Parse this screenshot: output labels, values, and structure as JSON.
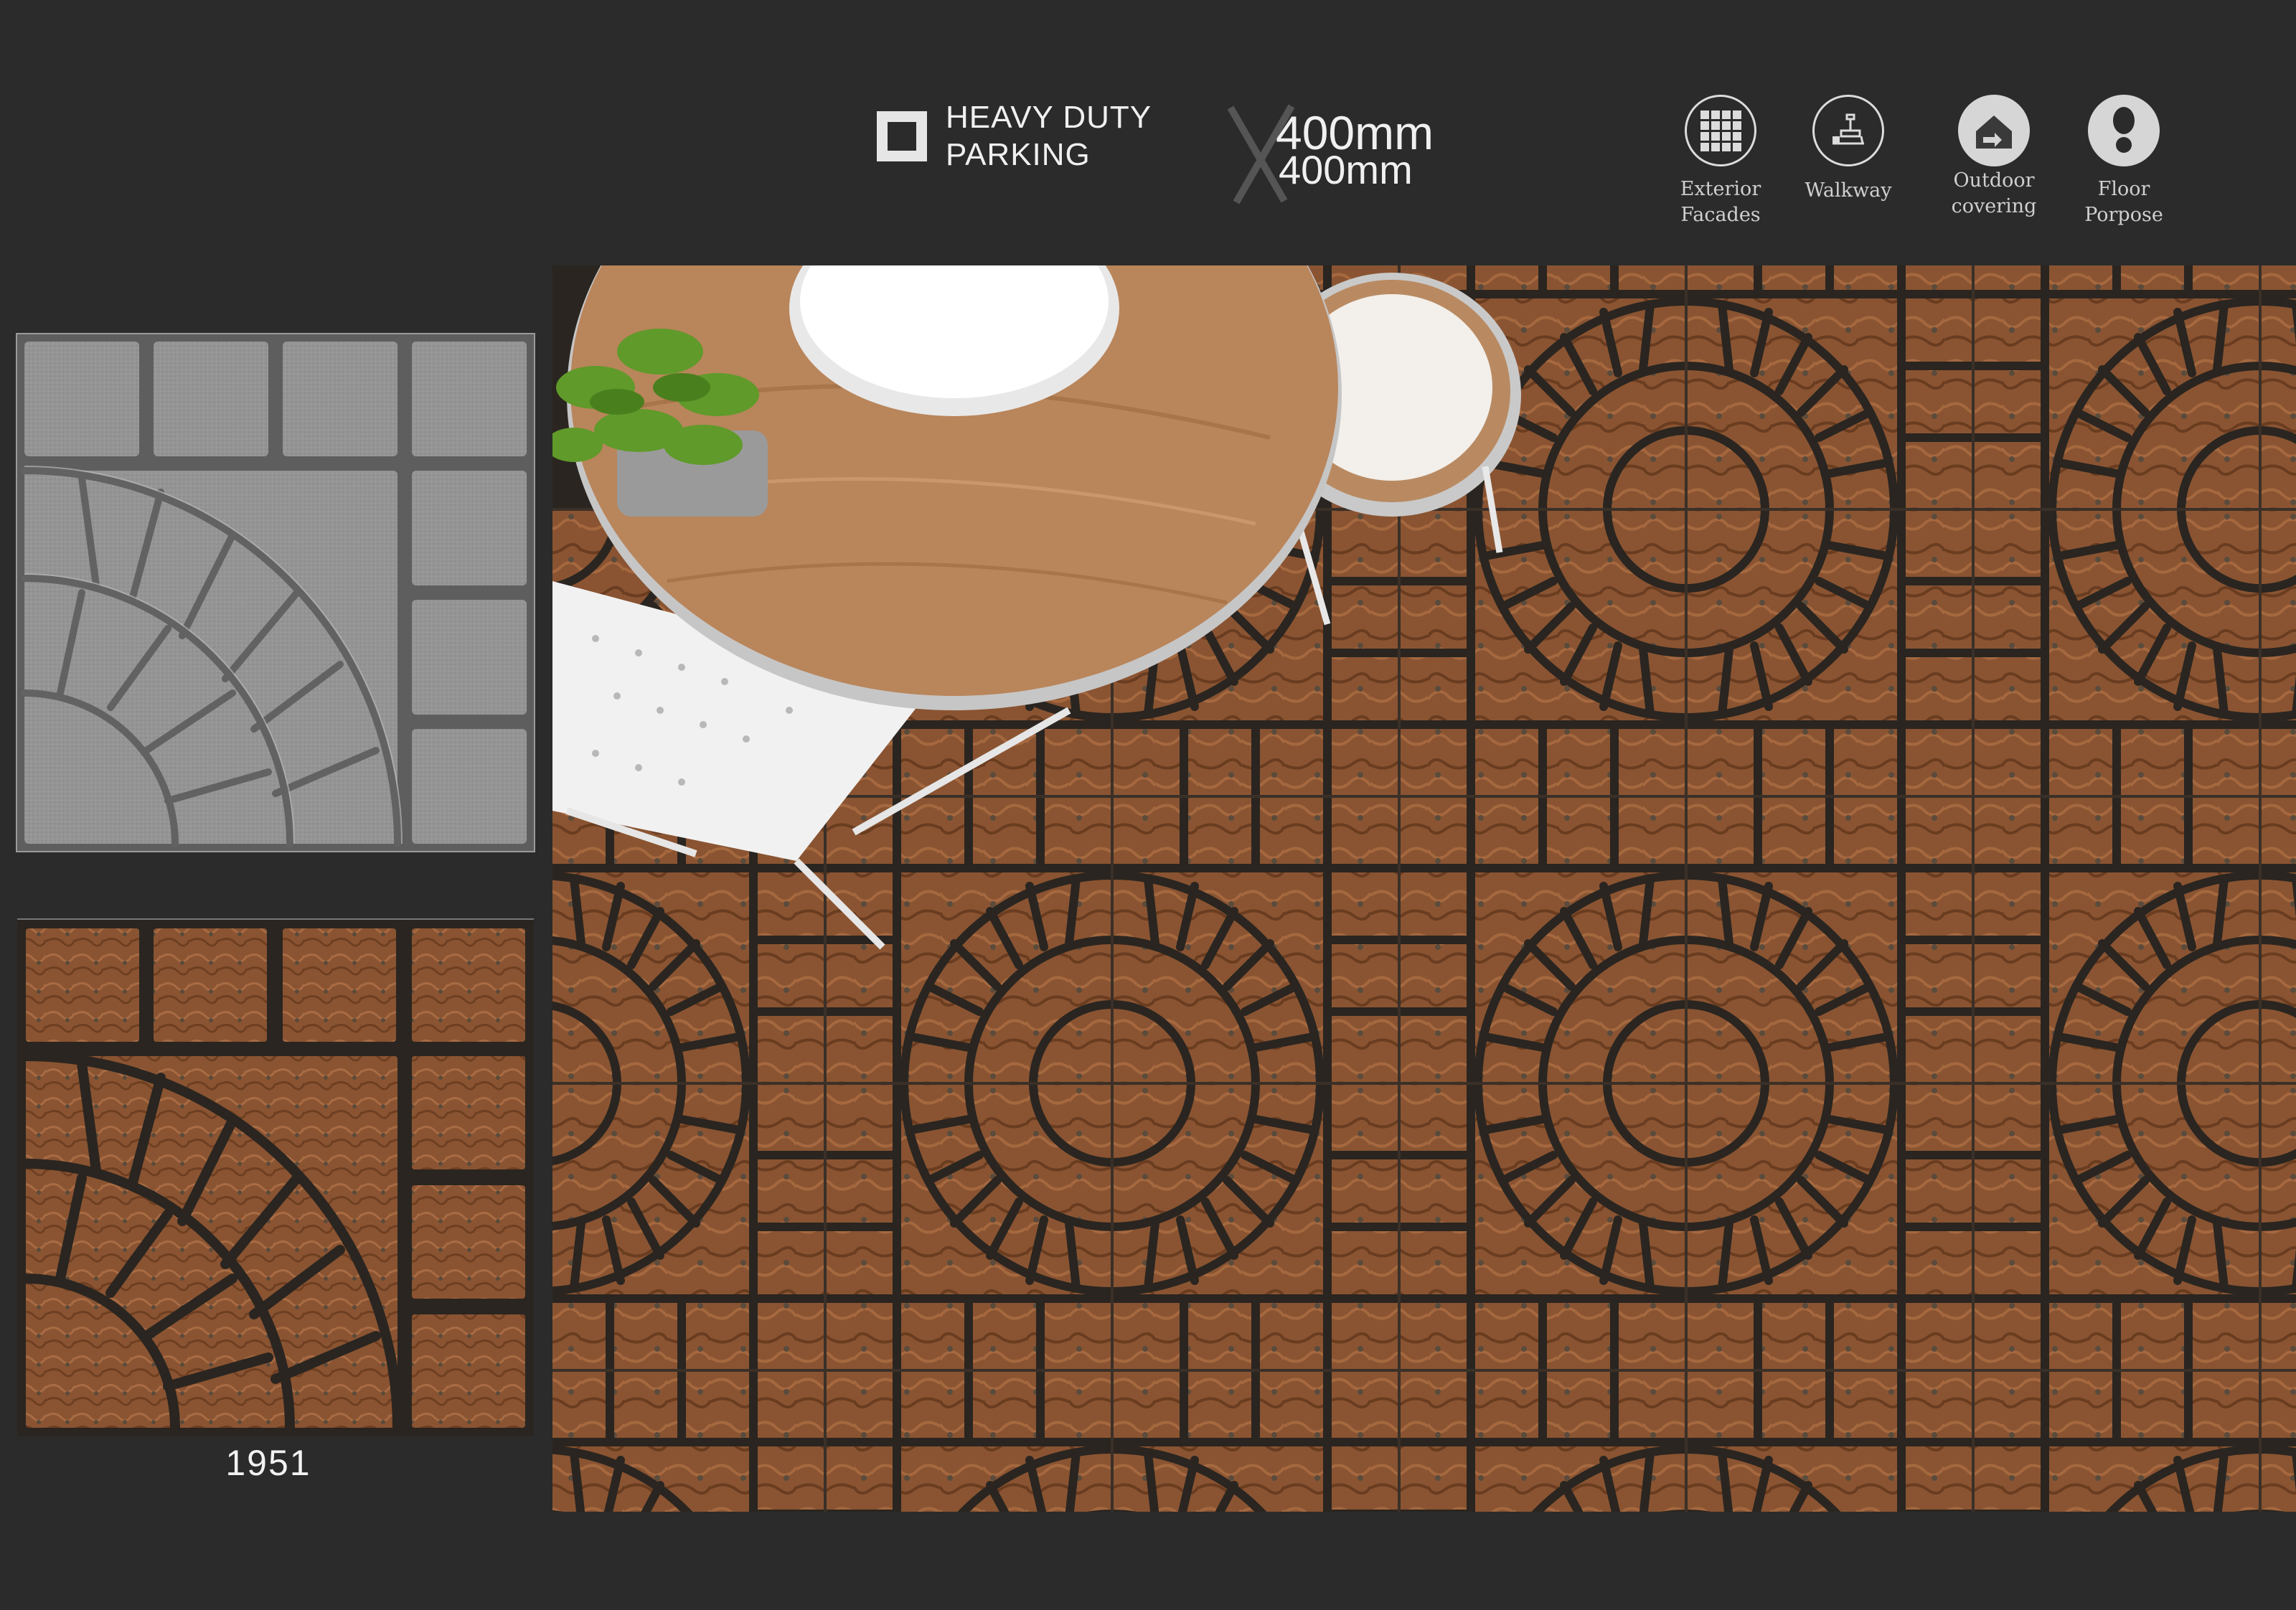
{
  "header": {
    "feature_line_1": "HEAVY DUTY",
    "feature_line_2": "PARKING",
    "size_width": "400mm",
    "size_height": "400mm"
  },
  "applications": [
    {
      "icon": "building-grid-icon",
      "line1": "Exterior",
      "line2": "Facades"
    },
    {
      "icon": "walkway-icon",
      "line1": "Walkway",
      "line2": ""
    },
    {
      "icon": "outdoor-house-icon",
      "line1": "Outdoor",
      "line2": "covering"
    },
    {
      "icon": "footprint-icon",
      "line1": "Floor",
      "line2": "Porpose"
    }
  ],
  "product": {
    "code": "1951"
  },
  "colors": {
    "background": "#2b2b2b",
    "tile_gray": "#8f8f8f",
    "tile_brown": "#8a5432",
    "joint_dark": "#2a2520",
    "table_wood": "#b9855b"
  }
}
